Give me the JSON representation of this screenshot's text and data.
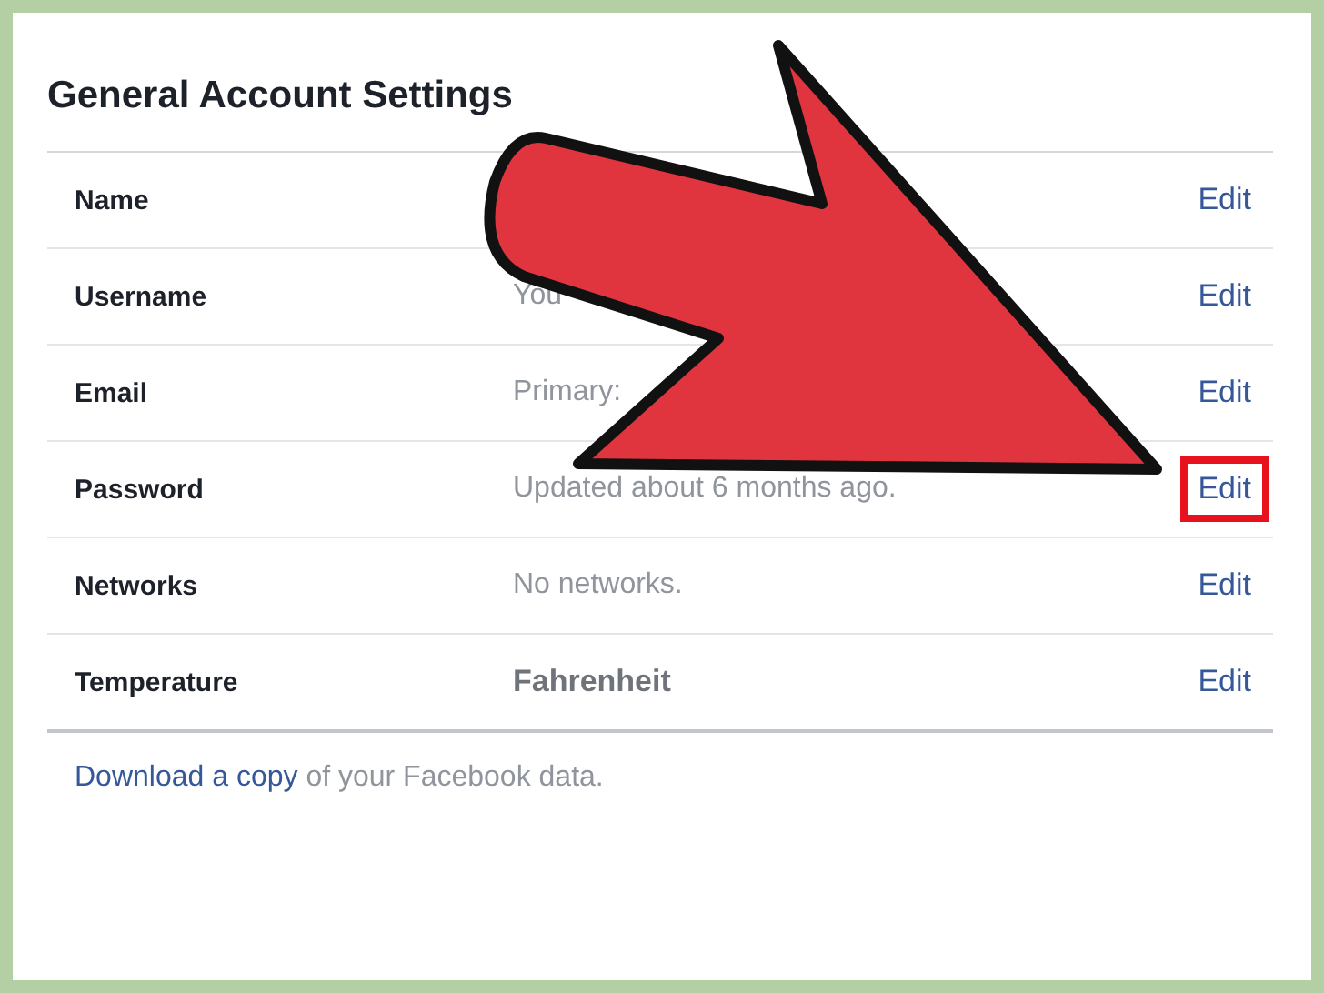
{
  "title": "General Account Settings",
  "rows": [
    {
      "label": "Name",
      "action": "Edit",
      "highlighted": false
    },
    {
      "label": "Username",
      "value": "You",
      "strong": false,
      "action": "Edit",
      "highlighted": false
    },
    {
      "label": "Email",
      "value": "Primary:",
      "strong": false,
      "action": "Edit",
      "highlighted": false
    },
    {
      "label": "Password",
      "value": "Updated about 6 months ago.",
      "strong": false,
      "action": "Edit",
      "highlighted": true
    },
    {
      "label": "Networks",
      "value": "No networks.",
      "strong": false,
      "action": "Edit",
      "highlighted": false
    },
    {
      "label": "Temperature",
      "value": "Fahrenheit",
      "strong": true,
      "action": "Edit",
      "highlighted": false
    }
  ],
  "footer": {
    "link": "Download a copy",
    "text": " of your Facebook data."
  }
}
